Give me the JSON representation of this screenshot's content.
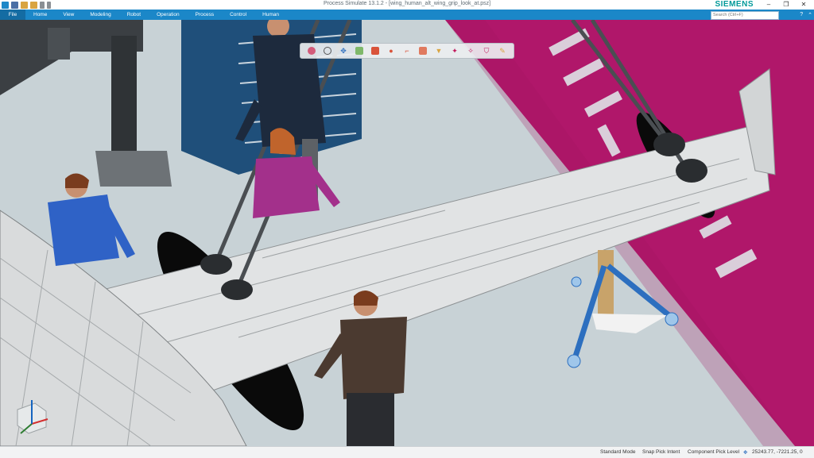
{
  "window": {
    "title": "Process Simulate 13.1.2 - [wing_human_alt_wing_grip_look_at.psz]",
    "brand": "SIEMENS",
    "controls": [
      "–",
      "❐",
      "✕"
    ]
  },
  "menu": {
    "file": "File",
    "items": [
      "Home",
      "View",
      "Modeling",
      "Robot",
      "Operation",
      "Process",
      "Control",
      "Human"
    ],
    "search_placeholder": "Search (Ctrl+F)"
  },
  "status": {
    "mode": "Standard Mode",
    "snap": "Snap Pick Intent",
    "pick_level": "Component Pick Level",
    "coords": "25243.77, -7221.25, 0"
  },
  "colors": {
    "menubar": "#1b87c8",
    "floor": "#c9d2d6",
    "magenta": "#b0176a",
    "brand": "#009999"
  },
  "toolbar_icons": [
    "circle-select-icon",
    "zoom-icon",
    "pan-icon",
    "cube-view-icon",
    "render-mode-icon",
    "pin-icon",
    "snap-icon",
    "box-icon",
    "paint-icon",
    "measure-icon",
    "section-icon",
    "shield-icon",
    "pencil-icon"
  ]
}
